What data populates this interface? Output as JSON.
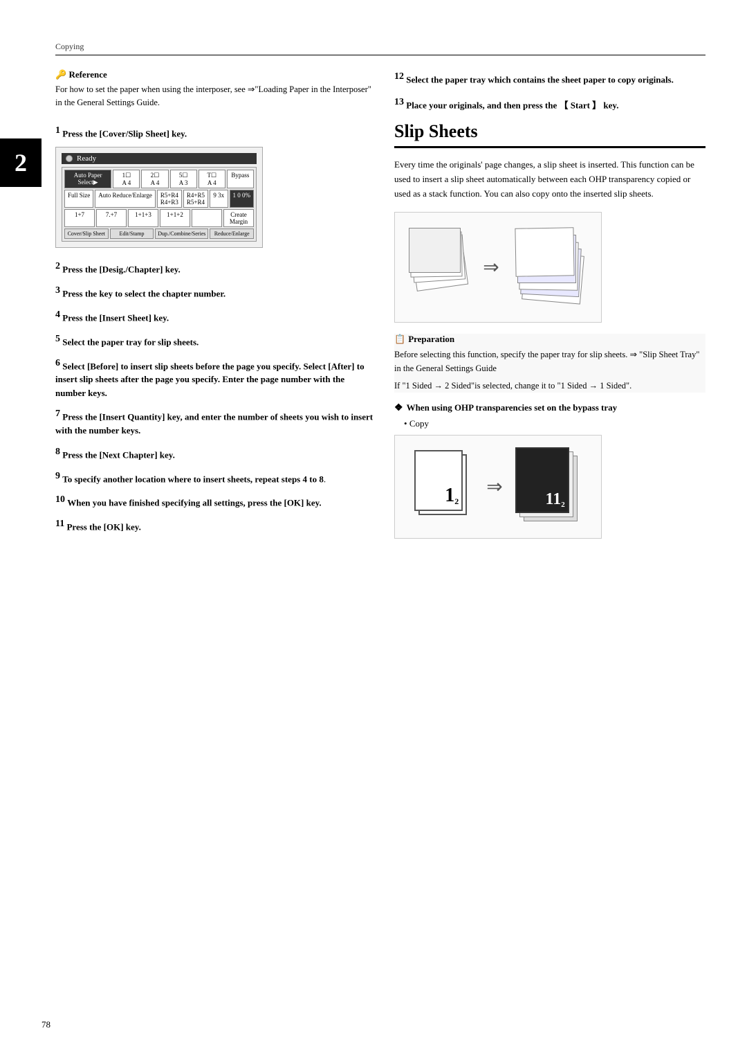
{
  "header": {
    "breadcrumb": "Copying"
  },
  "chapter": {
    "number": "2"
  },
  "reference": {
    "title": "Reference",
    "icon": "🔑",
    "text": "For how to set the paper when using the interposer, see ⇒\"Loading Paper in the Interposer\" in the General Settings Guide."
  },
  "left_steps": [
    {
      "num": "1",
      "text": "Press the [Cover/Slip Sheet] key."
    },
    {
      "num": "2",
      "text": "Press the [Desig./Chapter] key."
    },
    {
      "num": "3",
      "text": "Press the key to select the chapter number."
    },
    {
      "num": "4",
      "text": "Press the [Insert Sheet] key."
    },
    {
      "num": "5",
      "text": "Select the paper tray for slip sheets."
    },
    {
      "num": "6",
      "text": "Select [Before] to insert slip sheets before the page you specify. Select [After] to insert slip sheets after the page you specify. Enter the page number with the number keys."
    },
    {
      "num": "7",
      "text": "Press the [Insert Quantity] key, and enter the number of sheets you wish to insert with the number keys."
    },
    {
      "num": "8",
      "text": "Press the [Next Chapter] key."
    },
    {
      "num": "9",
      "text": "To specify another location where to insert sheets, repeat steps 4 to 8."
    },
    {
      "num": "10",
      "text": "When you have finished specifying all settings, press the [OK] key."
    },
    {
      "num": "11",
      "text": "Press the [OK] key."
    }
  ],
  "right_steps": [
    {
      "num": "12",
      "text": "Select the paper tray which contains the sheet paper to copy originals."
    },
    {
      "num": "13",
      "text": "Place your originals, and then press the [ Start ] key."
    }
  ],
  "screen": {
    "title": "Ready",
    "rows": [
      [
        "Auto Paper Select▶",
        "1☐ A4",
        "2☐ A4",
        "5☐ A3",
        "T☐ A4",
        "Bypass"
      ],
      [
        "Full Size",
        "Auto Reduce/Enlarge",
        "R5+R4 R4+R3",
        "R4+R5 R5+R4",
        "9 3x",
        "100%"
      ],
      [
        "1+7",
        "7.+7",
        "1+1+3",
        "1+1+2",
        "",
        "Create Margin"
      ],
      [
        "Cover/Slip Sheet",
        "Edit/Stamp",
        "Dup./Combine/Series",
        "Reduce/Enlarge"
      ]
    ]
  },
  "slip_sheets": {
    "title": "Slip Sheets",
    "intro": "Every time the originals' page changes, a slip sheet is inserted. This function can be used to insert a slip sheet automatically between each OHP transparency copied or used as a stack function. You can also copy onto the inserted slip sheets."
  },
  "preparation": {
    "title": "Preparation",
    "icon": "📋",
    "lines": [
      "Before selecting this function, specify the paper tray for slip sheets. ⇒ \"Slip Sheet Tray\" in the General Settings Guide",
      "If \"1 Sided → 2 Sided\"is selected, change it to \"1 Sided → 1 Sided\"."
    ]
  },
  "warning": {
    "title": "When using OHP transparencies set on the bypass tray",
    "diamond": "❖"
  },
  "copy_label": "Copy",
  "bullet": "•",
  "page_number": "78",
  "step4_ref": "4",
  "step8_ref": "8"
}
